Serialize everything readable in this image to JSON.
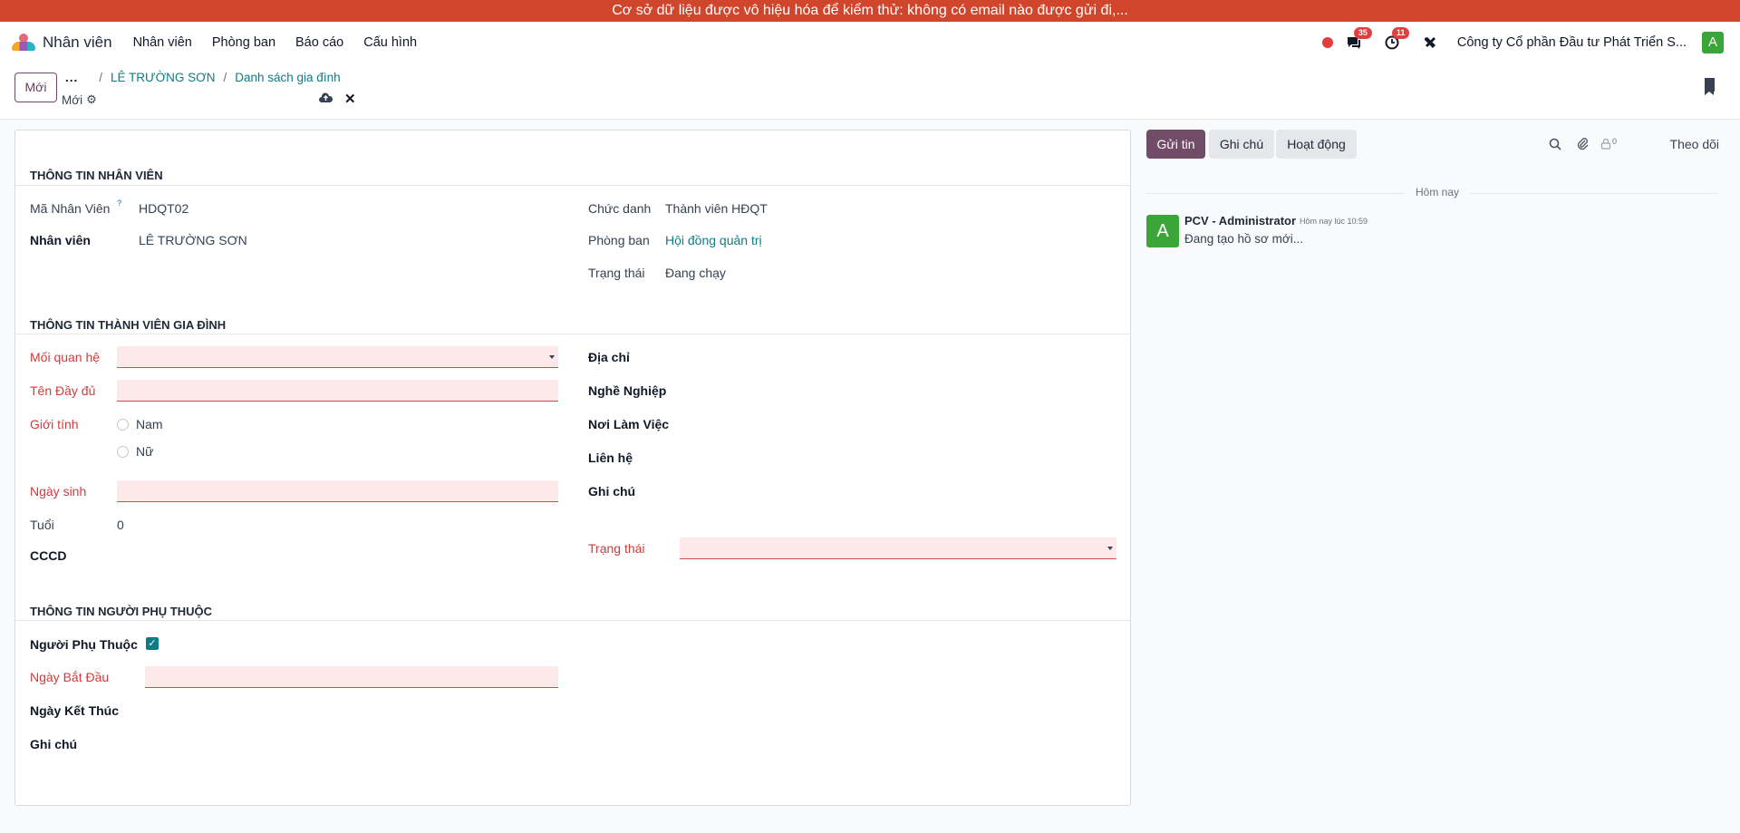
{
  "banner": "Cơ sở dữ liệu được vô hiệu hóa để kiểm thử: không có email nào được gửi đi,...",
  "navbar": {
    "app_name": "Nhân viên",
    "menu": [
      "Nhân viên",
      "Phòng ban",
      "Báo cáo",
      "Cấu hình"
    ],
    "messages_count": "35",
    "activities_count": "11",
    "company": "Công ty Cổ phần Đầu tư Phát Triển S...",
    "user_initial": "A"
  },
  "control": {
    "new_button": "Mới",
    "breadcrumb_dots": "...",
    "breadcrumb": [
      "LÊ TRƯỜNG SƠN",
      "Danh sách gia đình"
    ],
    "record_name": "Mới"
  },
  "form": {
    "employee_section": {
      "title": "THÔNG TIN NHÂN VIÊN",
      "code_label": "Mã Nhân Viên",
      "code_help": "?",
      "code_value": "HDQT02",
      "employee_label": "Nhân viên",
      "employee_value": "LÊ TRƯỜNG SƠN",
      "job_label": "Chức danh",
      "job_value": "Thành viên HĐQT",
      "dept_label": "Phòng ban",
      "dept_value": "Hội đồng quản trị",
      "state_label": "Trạng thái",
      "state_value": "Đang chạy"
    },
    "family_section": {
      "title": "THÔNG TIN THÀNH VIÊN GIA ĐÌNH",
      "relation_label": "Mối quan hệ",
      "fullname_label": "Tên Đầy đủ",
      "gender_label": "Giới tính",
      "gender_options": [
        "Nam",
        "Nữ"
      ],
      "birthday_label": "Ngày sinh",
      "age_label": "Tuổi",
      "age_value": "0",
      "cccd_label": "CCCD",
      "address_label": "Địa chỉ",
      "job_label": "Nghề Nghiệp",
      "workplace_label": "Nơi Làm Việc",
      "contact_label": "Liên hệ",
      "note_label": "Ghi chú",
      "state_label": "Trạng thái"
    },
    "dependent_section": {
      "title": "THÔNG TIN NGƯỜI PHỤ THUỘC",
      "dependent_label": "Người Phụ Thuộc",
      "dependent_checked": true,
      "start_label": "Ngày Bắt Đầu",
      "end_label": "Ngày Kết Thúc",
      "note_label": "Ghi chú"
    }
  },
  "chatter": {
    "send_message": "Gửi tin",
    "log_note": "Ghi chú",
    "activities": "Hoạt động",
    "followers_count": "0",
    "follow": "Theo dõi",
    "day_separator": "Hôm nay",
    "message": {
      "avatar_initial": "A",
      "author": "PCV - Administrator",
      "time": "Hôm nay lúc 10:59",
      "body": "Đang tạo hồ sơ mới..."
    }
  },
  "colors": {
    "banner": "#d0462c",
    "primary": "#714b67",
    "link": "#0e7c86",
    "required": "#d13b3b",
    "avatar": "#3aa637"
  }
}
